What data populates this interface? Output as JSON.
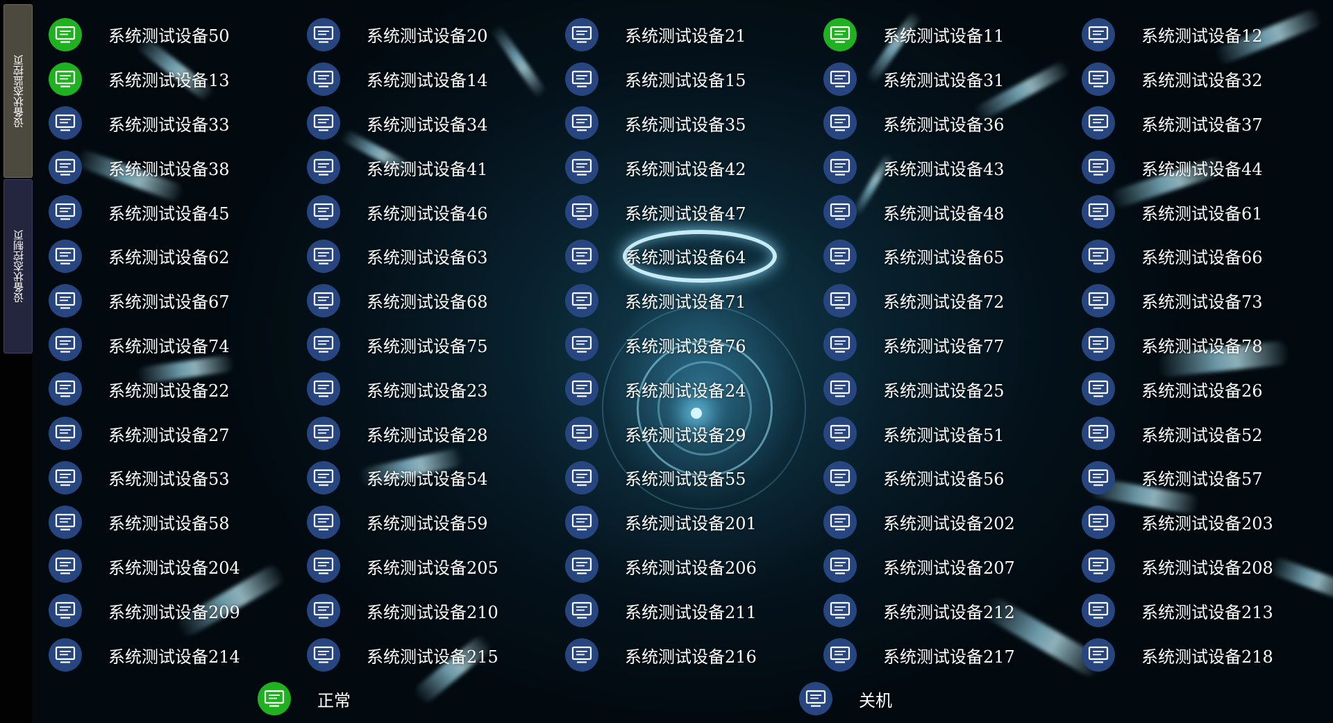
{
  "tabs": [
    {
      "label": "设备状态监控页",
      "active": true
    },
    {
      "label": "设备状态控制页",
      "active": false
    }
  ],
  "colors": {
    "normal": "#1fb11f",
    "off": "#27467f",
    "tab_active": "#4c4a3e",
    "tab_inactive": "#24263f"
  },
  "icons": {
    "device": "monitor-icon"
  },
  "devices": [
    {
      "label": "系统测试设备50",
      "status": "normal"
    },
    {
      "label": "系统测试设备20",
      "status": "off"
    },
    {
      "label": "系统测试设备21",
      "status": "off"
    },
    {
      "label": "系统测试设备11",
      "status": "normal"
    },
    {
      "label": "系统测试设备12",
      "status": "off"
    },
    {
      "label": "系统测试设备13",
      "status": "normal"
    },
    {
      "label": "系统测试设备14",
      "status": "off"
    },
    {
      "label": "系统测试设备15",
      "status": "off"
    },
    {
      "label": "系统测试设备31",
      "status": "off"
    },
    {
      "label": "系统测试设备32",
      "status": "off"
    },
    {
      "label": "系统测试设备33",
      "status": "off"
    },
    {
      "label": "系统测试设备34",
      "status": "off"
    },
    {
      "label": "系统测试设备35",
      "status": "off"
    },
    {
      "label": "系统测试设备36",
      "status": "off"
    },
    {
      "label": "系统测试设备37",
      "status": "off"
    },
    {
      "label": "系统测试设备38",
      "status": "off"
    },
    {
      "label": "系统测试设备41",
      "status": "off"
    },
    {
      "label": "系统测试设备42",
      "status": "off"
    },
    {
      "label": "系统测试设备43",
      "status": "off"
    },
    {
      "label": "系统测试设备44",
      "status": "off"
    },
    {
      "label": "系统测试设备45",
      "status": "off"
    },
    {
      "label": "系统测试设备46",
      "status": "off"
    },
    {
      "label": "系统测试设备47",
      "status": "off"
    },
    {
      "label": "系统测试设备48",
      "status": "off"
    },
    {
      "label": "系统测试设备61",
      "status": "off"
    },
    {
      "label": "系统测试设备62",
      "status": "off"
    },
    {
      "label": "系统测试设备63",
      "status": "off"
    },
    {
      "label": "系统测试设备64",
      "status": "off"
    },
    {
      "label": "系统测试设备65",
      "status": "off"
    },
    {
      "label": "系统测试设备66",
      "status": "off"
    },
    {
      "label": "系统测试设备67",
      "status": "off"
    },
    {
      "label": "系统测试设备68",
      "status": "off"
    },
    {
      "label": "系统测试设备71",
      "status": "off"
    },
    {
      "label": "系统测试设备72",
      "status": "off"
    },
    {
      "label": "系统测试设备73",
      "status": "off"
    },
    {
      "label": "系统测试设备74",
      "status": "off"
    },
    {
      "label": "系统测试设备75",
      "status": "off"
    },
    {
      "label": "系统测试设备76",
      "status": "off"
    },
    {
      "label": "系统测试设备77",
      "status": "off"
    },
    {
      "label": "系统测试设备78",
      "status": "off"
    },
    {
      "label": "系统测试设备22",
      "status": "off"
    },
    {
      "label": "系统测试设备23",
      "status": "off"
    },
    {
      "label": "系统测试设备24",
      "status": "off"
    },
    {
      "label": "系统测试设备25",
      "status": "off"
    },
    {
      "label": "系统测试设备26",
      "status": "off"
    },
    {
      "label": "系统测试设备27",
      "status": "off"
    },
    {
      "label": "系统测试设备28",
      "status": "off"
    },
    {
      "label": "系统测试设备29",
      "status": "off"
    },
    {
      "label": "系统测试设备51",
      "status": "off"
    },
    {
      "label": "系统测试设备52",
      "status": "off"
    },
    {
      "label": "系统测试设备53",
      "status": "off"
    },
    {
      "label": "系统测试设备54",
      "status": "off"
    },
    {
      "label": "系统测试设备55",
      "status": "off"
    },
    {
      "label": "系统测试设备56",
      "status": "off"
    },
    {
      "label": "系统测试设备57",
      "status": "off"
    },
    {
      "label": "系统测试设备58",
      "status": "off"
    },
    {
      "label": "系统测试设备59",
      "status": "off"
    },
    {
      "label": "系统测试设备201",
      "status": "off"
    },
    {
      "label": "系统测试设备202",
      "status": "off"
    },
    {
      "label": "系统测试设备203",
      "status": "off"
    },
    {
      "label": "系统测试设备204",
      "status": "off"
    },
    {
      "label": "系统测试设备205",
      "status": "off"
    },
    {
      "label": "系统测试设备206",
      "status": "off"
    },
    {
      "label": "系统测试设备207",
      "status": "off"
    },
    {
      "label": "系统测试设备208",
      "status": "off"
    },
    {
      "label": "系统测试设备209",
      "status": "off"
    },
    {
      "label": "系统测试设备210",
      "status": "off"
    },
    {
      "label": "系统测试设备211",
      "status": "off"
    },
    {
      "label": "系统测试设备212",
      "status": "off"
    },
    {
      "label": "系统测试设备213",
      "status": "off"
    },
    {
      "label": "系统测试设备214",
      "status": "off"
    },
    {
      "label": "系统测试设备215",
      "status": "off"
    },
    {
      "label": "系统测试设备216",
      "status": "off"
    },
    {
      "label": "系统测试设备217",
      "status": "off"
    },
    {
      "label": "系统测试设备218",
      "status": "off"
    }
  ],
  "legend": {
    "normal_label": "正常",
    "off_label": "关机"
  }
}
